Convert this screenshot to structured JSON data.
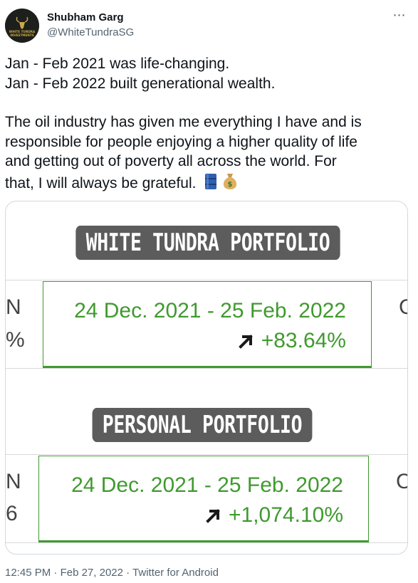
{
  "author": {
    "display_name": "Shubham Garg",
    "handle": "@WhiteTundraSG",
    "avatar_text_top": "WHITE TUNDRA",
    "avatar_text_bottom": "INVESTMENTS"
  },
  "more_icon": "⋯",
  "tweet": {
    "line1": "Jan - Feb 2021 was life-changing.",
    "line2": "Jan - Feb 2022 built generational wealth.",
    "line3": "The oil industry has given me everything I have and is",
    "line4": "responsible for people enjoying a higher quality of life",
    "line5": "and getting out of poverty all across the world. For",
    "line6": "that, I will always be grateful.",
    "emojis": [
      "oil-drum-icon",
      "money-bag-icon"
    ]
  },
  "media": {
    "portfolio1": {
      "title": "WHITE TUNDRA PORTFOLIO",
      "date_range": "24 Dec. 2021 - 25 Feb. 2022",
      "change": "+83.64%",
      "left_edge_top": "N",
      "left_edge_bottom": "%",
      "right_edge": "C"
    },
    "portfolio2": {
      "title": "PERSONAL PORTFOLIO",
      "date_range": "24 Dec. 2021 - 25 Feb. 2022",
      "change": "+1,074.10%",
      "left_edge_top": "N",
      "left_edge_bottom": "6",
      "right_edge": "C"
    },
    "accent_color": "#3f9a2e",
    "pill_color": "#5c5c5c"
  },
  "meta": {
    "time": "12:45 PM",
    "sep1": "·",
    "date": "Feb 27, 2022",
    "sep2": "·",
    "source": "Twitter for Android"
  }
}
